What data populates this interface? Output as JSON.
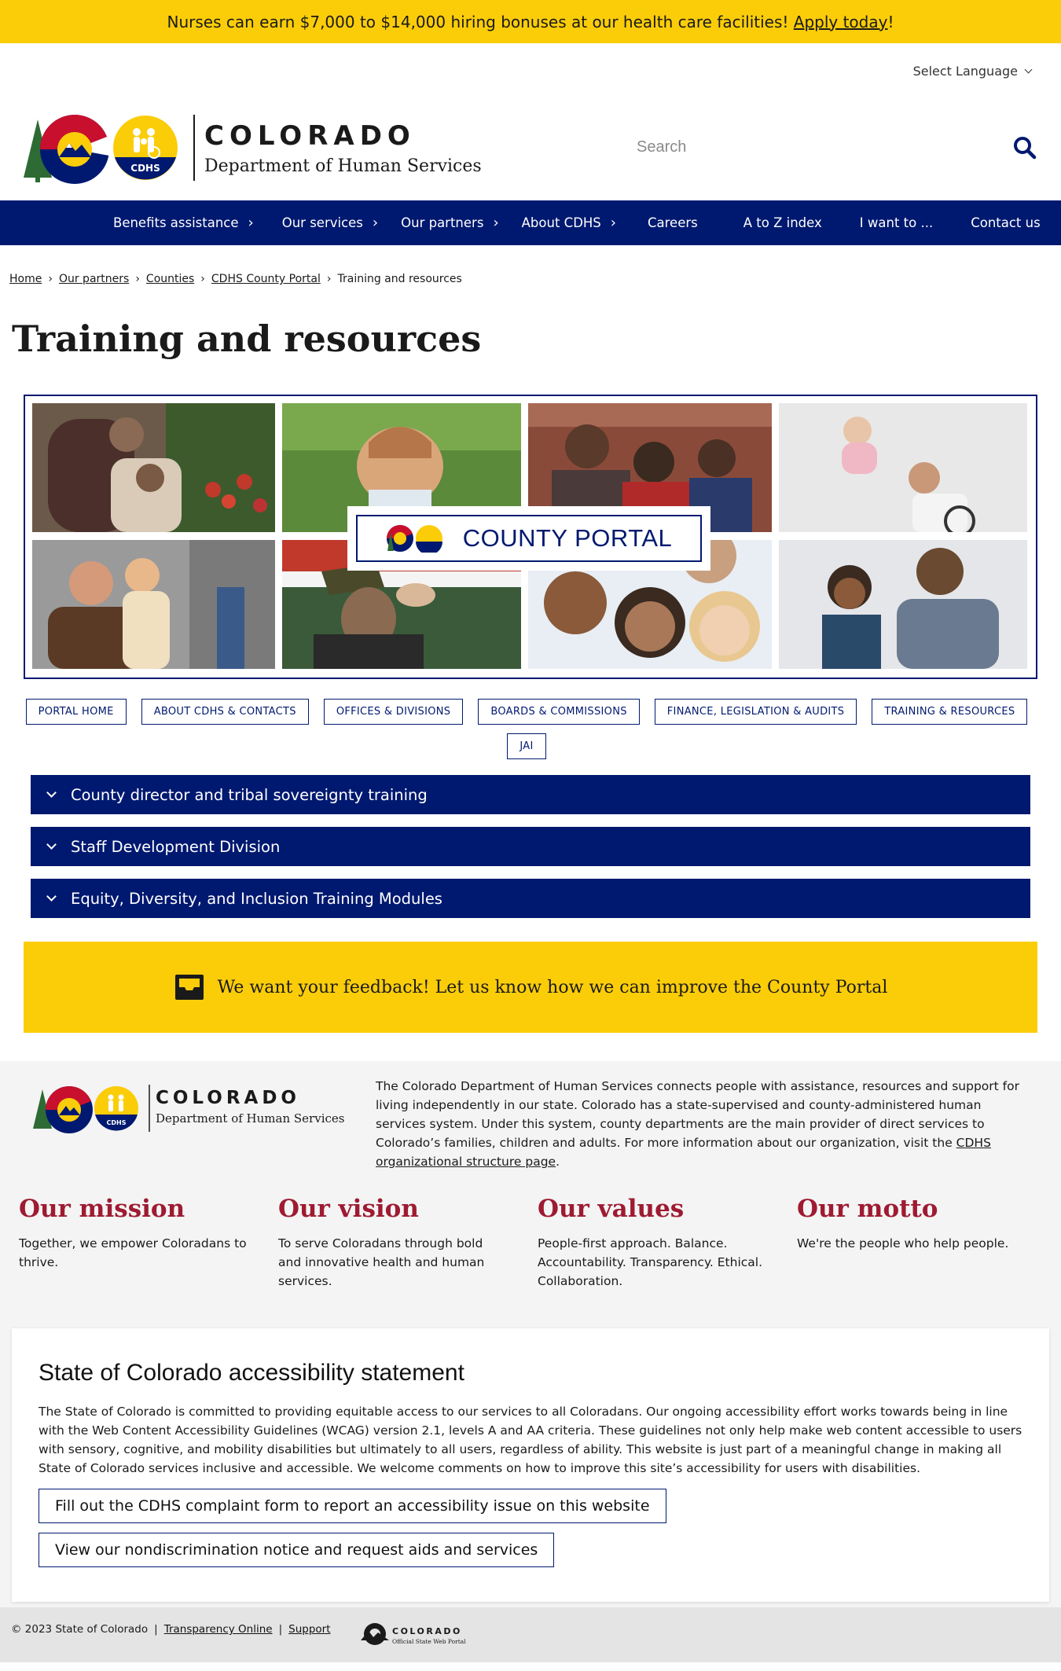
{
  "alert": {
    "text": "Nurses can earn $7,000 to $14,000 hiring bonuses at our health care facilities! ",
    "link": "Apply today",
    "suffix": "!"
  },
  "language": {
    "label": "Select Language"
  },
  "logo": {
    "state": "COLORADO",
    "department": "Department of Human Services",
    "badge": "CDHS"
  },
  "search": {
    "placeholder": "Search"
  },
  "nav": {
    "items": [
      {
        "label": "Benefits assistance",
        "arrow": "›"
      },
      {
        "label": "Our services",
        "arrow": "›"
      },
      {
        "label": "Our partners",
        "arrow": "›"
      },
      {
        "label": "About CDHS",
        "arrow": "›"
      },
      {
        "label": "Careers"
      },
      {
        "label": "A to Z index"
      },
      {
        "label": "I want to ..."
      },
      {
        "label": "Contact us"
      }
    ]
  },
  "breadcrumb": {
    "items": [
      "Home",
      "Our partners",
      "Counties",
      "CDHS County Portal"
    ],
    "current": "Training and resources"
  },
  "page_title": "Training and resources",
  "hero": {
    "badge_text": "COUNTY PORTAL"
  },
  "subnav": {
    "buttons": [
      "PORTAL HOME",
      "ABOUT CDHS & CONTACTS",
      "OFFICES & DIVISIONS",
      "BOARDS & COMMISSIONS",
      "FINANCE, LEGISLATION & AUDITS",
      "TRAINING & RESOURCES",
      "JAI"
    ]
  },
  "accordions": [
    "County director and tribal sovereignty training",
    "Staff Development Division",
    "Equity, Diversity, and Inclusion Training Modules"
  ],
  "feedback": {
    "text": "We want your feedback! Let us know how we can improve the County Portal"
  },
  "footer": {
    "description": "The Colorado Department of Human Services connects people with assistance, resources and support for living independently in our state. Colorado has a state-supervised and county-administered human services system. Under this system, county departments are the main provider of direct services to Colorado’s families, children and adults. For more information about our organization, visit the ",
    "description_link": "CDHS organizational structure page",
    "description_end": ".",
    "columns": [
      {
        "title": "Our mission",
        "text": "Together, we empower Coloradans to thrive."
      },
      {
        "title": "Our vision",
        "text": "To serve Coloradans through bold and innovative health and human services."
      },
      {
        "title": "Our values",
        "text": "People-first approach. Balance. Accountability. Transparency. Ethical. Collaboration."
      },
      {
        "title": "Our motto",
        "text": "We're the people who help people."
      }
    ],
    "accessibility": {
      "title": "State of Colorado accessibility statement",
      "text": "The State of Colorado is committed to providing equitable access to our services to all Coloradans. Our ongoing accessibility effort works towards being in line with the Web Content Accessibility Guidelines (WCAG) version 2.1, levels A and AA criteria. These guidelines not only help make web content accessible to users with sensory, cognitive, and mobility disabilities but ultimately to all users, regardless of ability. This website is just part of a meaningful change in making all State of Colorado services inclusive and accessible. We welcome comments on how to improve this site’s accessibility for users with disabilities.",
      "link1": "Fill out the CDHS complaint form to report an accessibility issue on this website",
      "link2": "View our nondiscrimination notice and request aids and services"
    },
    "bottom": {
      "copyright": "© 2023 State of Colorado",
      "sep": "|",
      "links": [
        "Transparency Online",
        "Support"
      ],
      "co_logo_title": "COLORADO",
      "co_logo_sub": "Official State Web Portal"
    }
  },
  "colors": {
    "navy": "#001970",
    "yellow": "#fbcd09",
    "maroon": "#9e1b32"
  }
}
